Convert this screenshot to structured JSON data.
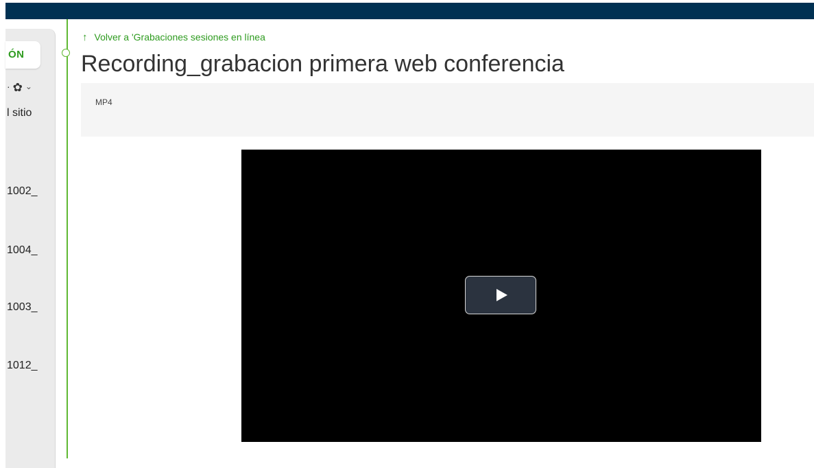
{
  "header": {
    "bar_color": "#003153"
  },
  "sidebar": {
    "active_button_label": "ÓN",
    "tools_prefix": "·",
    "settings_icon": "gear-icon",
    "site_link_label": "l sitio",
    "items": [
      {
        "label": "1002_"
      },
      {
        "label": "1004_"
      },
      {
        "label": "1003_"
      },
      {
        "label": "1012_"
      }
    ]
  },
  "main": {
    "back_link": {
      "arrow": "↑",
      "label": "Volver a 'Grabaciones sesiones en línea"
    },
    "title": "Recording_grabacion primera web conferencia",
    "format_label": "MP4",
    "video": {
      "play_icon": "play-icon"
    }
  },
  "colors": {
    "accent_green": "#2e9b1f",
    "timeline_green": "#5fb832",
    "video_bg": "#000000",
    "play_button_bg": "#2b333f"
  }
}
